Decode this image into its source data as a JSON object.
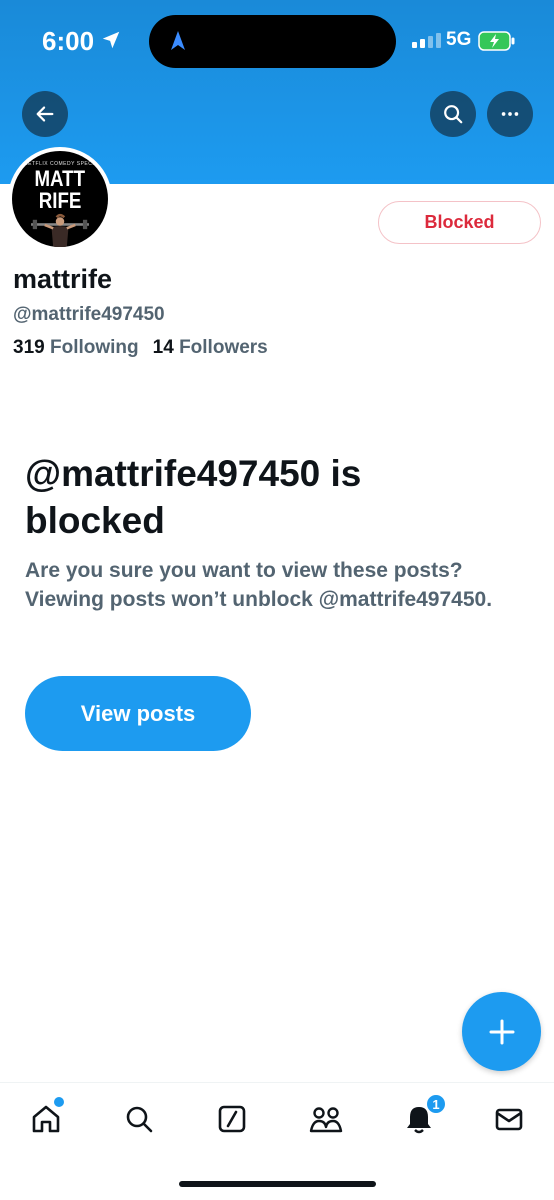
{
  "status_bar": {
    "time": "6:00",
    "network": "5G"
  },
  "profile": {
    "avatar_brand": "A NETFLIX COMEDY SPECIAL",
    "avatar_title_line1": "MATT",
    "avatar_title_line2": "RIFE",
    "display_name": "mattrife",
    "handle": "@mattrife497450",
    "following_count": "319",
    "following_label": "Following",
    "followers_count": "14",
    "followers_label": "Followers",
    "blocked_label": "Blocked"
  },
  "blocked_notice": {
    "title": "@mattrife497450 is blocked",
    "description": "Are you sure you want to view these posts? Viewing posts won’t unblock @mattrife497450.",
    "view_button": "View posts"
  },
  "tabbar": {
    "notifications_badge": "1"
  },
  "colors": {
    "accent": "#1d9bf0",
    "blocked_red": "#dc2a3c",
    "secondary_text": "#536471"
  }
}
